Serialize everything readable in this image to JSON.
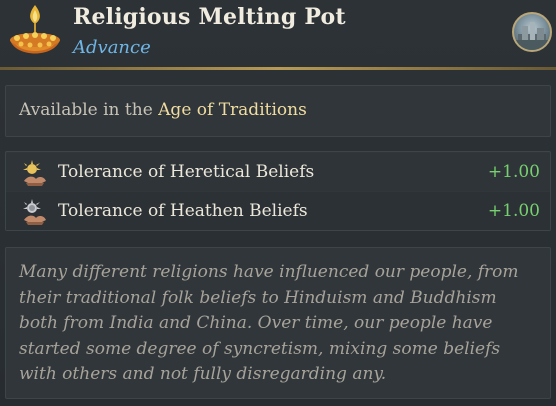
{
  "header": {
    "title": "Religious Melting Pot",
    "subtitle": "Advance",
    "icon": "lotus-candles-icon",
    "portrait": "city-portrait-icon"
  },
  "availability": {
    "prefix": "Available in the ",
    "age": "Age of Traditions"
  },
  "modifiers": [
    {
      "icon": "sun-hands-icon",
      "label": "Tolerance of Heretical Beliefs",
      "value": "+1.00"
    },
    {
      "icon": "moon-hands-icon",
      "label": "Tolerance of Heathen Beliefs",
      "value": "+1.00"
    }
  ],
  "description": "Many different religions have influenced our people, from their traditional folk beliefs to Hinduism and Buddhism both from India and China. Over time, our people have started some degree of syncretism, mixing some beliefs with others and not fully disregarding any.",
  "colors": {
    "title": "#f1ece0",
    "subtitle": "#6fb6e6",
    "age": "#f0dca0",
    "positive": "#78d070",
    "gold_divider": "#b89a55"
  }
}
